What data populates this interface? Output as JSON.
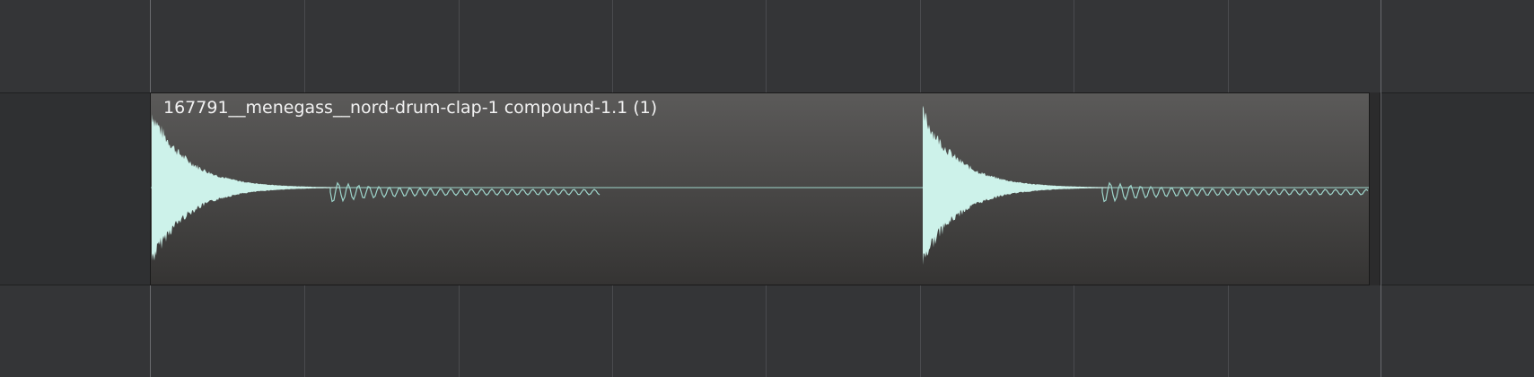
{
  "app": {
    "view": "audio-timeline-editor"
  },
  "region": {
    "name": "167791__menegass__nord-drum-clap-1 compound-1.1 (1)",
    "selected": false,
    "waveform_color": "#cdf2ea",
    "waveform_line_color": "#9fd6cc"
  },
  "colors": {
    "background": "#343537",
    "track_background": "#2f3032",
    "region_top": "#5b5a59",
    "region_bottom": "#353433",
    "gridline": "#4a4b4e"
  }
}
